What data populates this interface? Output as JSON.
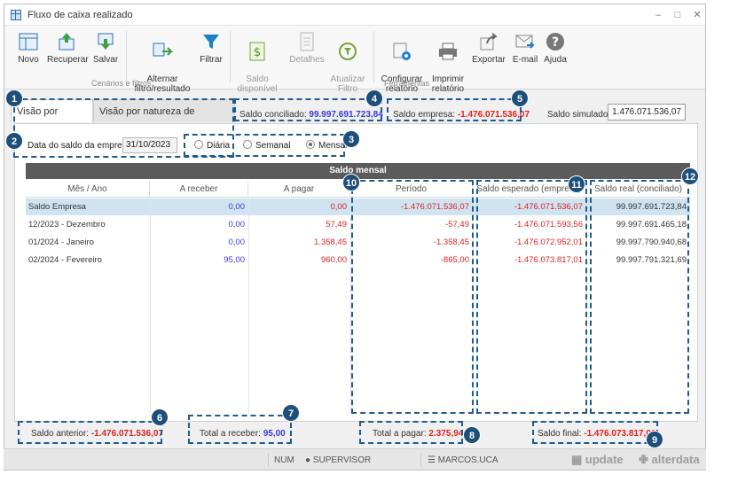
{
  "window": {
    "title": "Fluxo de caixa realizado"
  },
  "ribbon": {
    "buttons": [
      {
        "label": "Novo",
        "icon": "new-grid-icon"
      },
      {
        "label": "Recuperar",
        "icon": "recover-icon"
      },
      {
        "label": "Salvar",
        "icon": "save-icon"
      },
      {
        "label": "Alternar\nfiltro/resultado",
        "icon": "toggle-filter-icon"
      },
      {
        "label": "Filtrar",
        "icon": "filter-icon"
      },
      {
        "label": "Saldo\ndisponível",
        "icon": "balance-icon"
      },
      {
        "label": "Detalhes",
        "icon": "details-icon"
      },
      {
        "label": "Atualizar\nFiltro",
        "icon": "refresh-filter-icon"
      },
      {
        "label": "Configurar\nrelatório",
        "icon": "configure-report-icon"
      },
      {
        "label": "Imprimir\nrelatório",
        "icon": "print-icon"
      },
      {
        "label": "Exportar",
        "icon": "export-icon"
      },
      {
        "label": "E-mail",
        "icon": "email-icon"
      },
      {
        "label": "Ajuda",
        "icon": "help-icon"
      }
    ],
    "groups": [
      "Cenários e filtros",
      "Ferramentas"
    ]
  },
  "tabs": [
    "Visão por período",
    "Visão por natureza de lançamento"
  ],
  "summary": {
    "saldo_conciliado_label": "Saldo conciliado:",
    "saldo_conciliado": "99.997.691.723,84",
    "saldo_empresa_label": "Saldo empresa:",
    "saldo_empresa": "-1.476.071.536,07",
    "saldo_simulado_label": "Saldo simulado:",
    "saldo_simulado": "1.476.071.536,07"
  },
  "filters": {
    "date_label": "Data do saldo da empresa:",
    "date_value": "31/10/2023",
    "periodicity": [
      "Diária",
      "Semanal",
      "Mensal"
    ],
    "selected": "Mensal"
  },
  "grid": {
    "title": "Saldo mensal",
    "columns": [
      "Mês / Ano",
      "A receber",
      "A pagar",
      "Período",
      "Saldo esperado (empresa)",
      "Saldo real (conciliado)"
    ],
    "rows": [
      [
        "Saldo Empresa",
        "0,00",
        "0,00",
        "-1.476.071.536,07",
        "-1.476.071.536,07",
        "99.997.691.723,84"
      ],
      [
        "12/2023 - Dezembro",
        "0,00",
        "57,49",
        "-57,49",
        "-1.476.071.593,56",
        "99.997.691.465,18"
      ],
      [
        "01/2024 - Janeiro",
        "0,00",
        "1.358,45",
        "-1.358,45",
        "-1.476.072.952,01",
        "99.997.790.940,68"
      ],
      [
        "02/2024 - Fevereiro",
        "95,00",
        "960,00",
        "-865,00",
        "-1.476.073.817,01",
        "99.997.791.321,69"
      ]
    ]
  },
  "totals": {
    "saldo_anterior_label": "Saldo anterior:",
    "saldo_anterior": "-1.476.071.536,07",
    "total_receber_label": "Total a receber:",
    "total_receber": "95,00",
    "total_pagar_label": "Total a pagar:",
    "total_pagar": "2.375,94",
    "saldo_final_label": "Saldo final:",
    "saldo_final": "-1.476.073.817,01"
  },
  "status": {
    "num": "NUM",
    "user": "SUPERVISOR",
    "db": "MARCOS.UCA",
    "brand1": "update",
    "brand2": "alterdata"
  },
  "callouts": [
    "1",
    "2",
    "3",
    "4",
    "5",
    "6",
    "7",
    "8",
    "9",
    "10",
    "11",
    "12"
  ],
  "colors": {
    "callout": "#1d4f7a",
    "negative": "#e02020",
    "positive": "#3a3ad8",
    "selected_row": "#cfe4f0"
  }
}
